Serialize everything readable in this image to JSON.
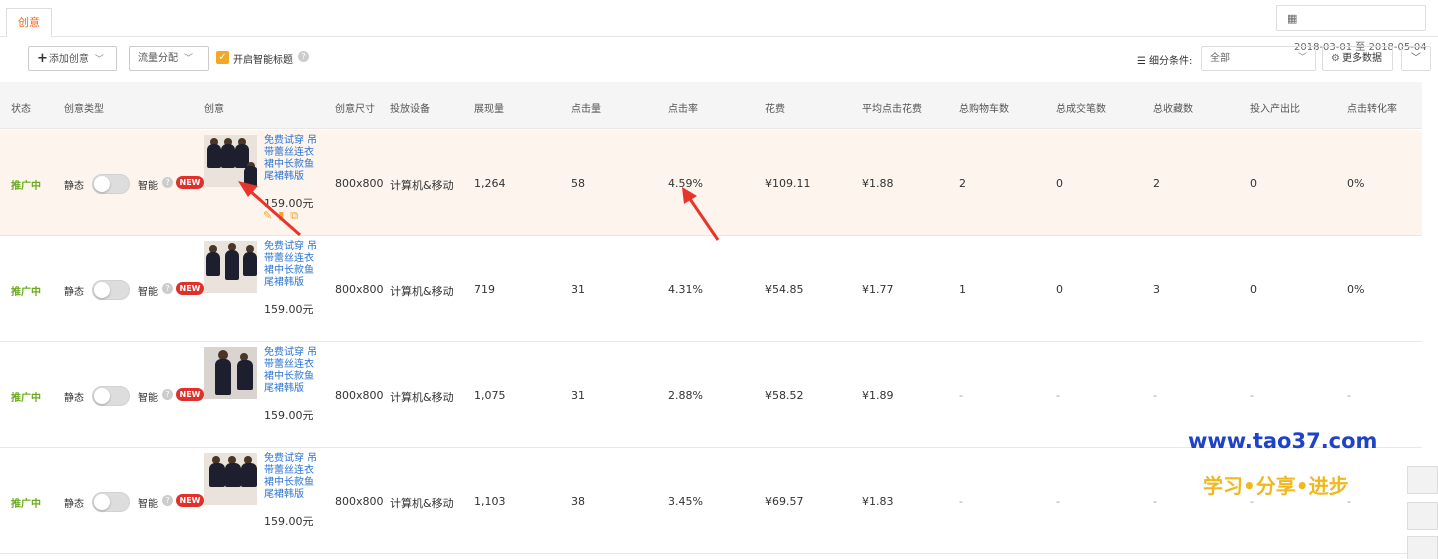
{
  "tab": {
    "label": "创意"
  },
  "date": {
    "range": "2018-03-01 至 2018-05-04",
    "calendar_icon": "calendar-icon"
  },
  "toolbar": {
    "add_label": "添加创意",
    "flow_label": "流量分配",
    "smart_title_label": "开启智能标题",
    "filter_label": "细分条件:",
    "filter_value": "全部",
    "more_data_label": "更多数据"
  },
  "columns": [
    "状态",
    "创意类型",
    "创意",
    "创意尺寸",
    "投放设备",
    "展现量",
    "点击量",
    "点击率",
    "花费",
    "平均点击花费",
    "总购物车数",
    "总成交笔数",
    "总收藏数",
    "投入产出比",
    "点击转化率"
  ],
  "rows": [
    {
      "status": "推广中",
      "static": "静态",
      "smart": "智能",
      "badge": "NEW",
      "title": "免费试穿 吊带蕾丝连衣裙中长款鱼尾裙韩版",
      "price": "159.00元",
      "size": "800x800",
      "device": "计算机&移动",
      "impressions": "1,264",
      "clicks": "58",
      "ctr": "4.59%",
      "cost": "¥109.11",
      "cpc": "¥1.88",
      "cart": "2",
      "orders": "0",
      "favs": "2",
      "roi": "0",
      "cvr": "0%"
    },
    {
      "status": "推广中",
      "static": "静态",
      "smart": "智能",
      "badge": "NEW",
      "title": "免费试穿 吊带蕾丝连衣裙中长款鱼尾裙韩版",
      "price": "159.00元",
      "size": "800x800",
      "device": "计算机&移动",
      "impressions": "719",
      "clicks": "31",
      "ctr": "4.31%",
      "cost": "¥54.85",
      "cpc": "¥1.77",
      "cart": "1",
      "orders": "0",
      "favs": "3",
      "roi": "0",
      "cvr": "0%"
    },
    {
      "status": "推广中",
      "static": "静态",
      "smart": "智能",
      "badge": "NEW",
      "title": "免费试穿 吊带蕾丝连衣裙中长款鱼尾裙韩版",
      "price": "159.00元",
      "size": "800x800",
      "device": "计算机&移动",
      "impressions": "1,075",
      "clicks": "31",
      "ctr": "2.88%",
      "cost": "¥58.52",
      "cpc": "¥1.89",
      "cart": "-",
      "orders": "-",
      "favs": "-",
      "roi": "-",
      "cvr": "-"
    },
    {
      "status": "推广中",
      "static": "静态",
      "smart": "智能",
      "badge": "NEW",
      "title": "免费试穿 吊带蕾丝连衣裙中长款鱼尾裙韩版",
      "price": "159.00元",
      "size": "800x800",
      "device": "计算机&移动",
      "impressions": "1,103",
      "clicks": "38",
      "ctr": "3.45%",
      "cost": "¥69.57",
      "cpc": "¥1.83",
      "cart": "-",
      "orders": "-",
      "favs": "-",
      "roi": "-",
      "cvr": "-"
    }
  ],
  "watermark": {
    "url": "www.tao37.com",
    "slogan": "学习•分享•进步"
  },
  "colors": {
    "accent": "#f26a21",
    "status": "#6aab1e",
    "link": "#2b73d2",
    "badge": "#e0302c",
    "annotation_arrow": "#e8342a"
  }
}
